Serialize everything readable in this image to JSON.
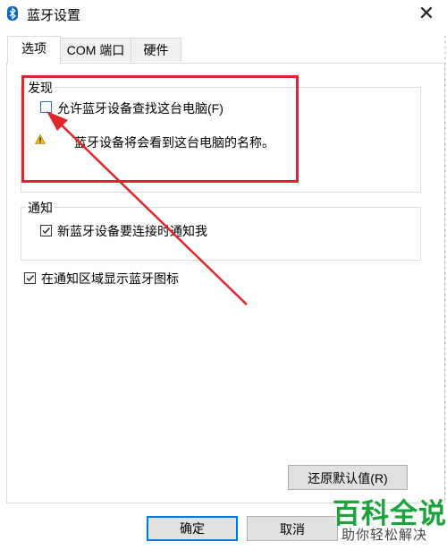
{
  "window": {
    "title": "蓝牙设置",
    "close_glyph": "✕"
  },
  "tabs": [
    {
      "label": "选项",
      "active": true
    },
    {
      "label": "COM 端口",
      "active": false
    },
    {
      "label": "硬件",
      "active": false
    }
  ],
  "discovery": {
    "group_label": "发现",
    "allow_discovery_label": "允许蓝牙设备查找这台电脑(F)",
    "allow_discovery_checked": false,
    "warning_text": "蓝牙设备将会看到这台电脑的名称。"
  },
  "notification": {
    "group_label": "通知",
    "notify_new_device_label": "新蓝牙设备要连接时通知我",
    "notify_new_device_checked": true
  },
  "show_tray_icon": {
    "label": "在通知区域显示蓝牙图标",
    "checked": true
  },
  "buttons": {
    "restore_defaults": "还原默认值(R)",
    "ok": "确定",
    "cancel": "取消"
  },
  "watermark": {
    "title": "百科全说",
    "subtitle": "助你轻松解决"
  },
  "colors": {
    "accent": "#0078d7",
    "highlight_red": "#e0262b",
    "watermark_green": "#1aa33b"
  }
}
